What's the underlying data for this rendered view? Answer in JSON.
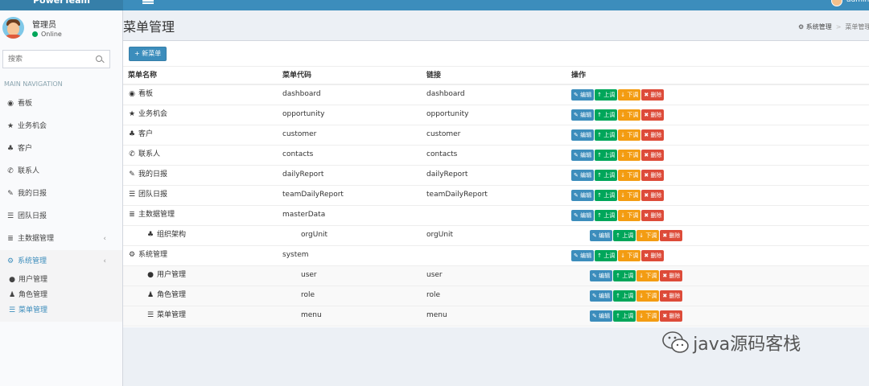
{
  "topbar": {
    "brand": "PowerTeam",
    "user": "admin"
  },
  "sidebar": {
    "user": {
      "name": "管理员",
      "status": "Online"
    },
    "search_placeholder": "搜索",
    "header": "MAIN NAVIGATION",
    "items": [
      {
        "label": "看板",
        "icon": "dashboard-icon"
      },
      {
        "label": "业务机会",
        "icon": "star-icon"
      },
      {
        "label": "客户",
        "icon": "sitemap-icon"
      },
      {
        "label": "联系人",
        "icon": "phone-icon"
      },
      {
        "label": "我的日报",
        "icon": "pin-icon"
      },
      {
        "label": "团队日报",
        "icon": "list-icon"
      },
      {
        "label": "主数据管理",
        "icon": "database-icon"
      },
      {
        "label": "系统管理",
        "icon": "cogs-icon"
      }
    ],
    "sub_items": [
      {
        "label": "用户管理",
        "icon": "user-icon"
      },
      {
        "label": "角色管理",
        "icon": "users-icon"
      },
      {
        "label": "菜单管理",
        "icon": "list-icon"
      }
    ]
  },
  "page": {
    "title": "菜单管理",
    "breadcrumb": {
      "parent": "系统管理",
      "current": "菜单管理"
    },
    "add_button": "+ 新菜单"
  },
  "table": {
    "headers": {
      "name": "菜单名称",
      "code": "菜单代码",
      "link": "链接",
      "actions": "操作"
    },
    "action_labels": {
      "edit": "编辑",
      "up": "上调",
      "down": "下调",
      "delete": "删除"
    },
    "rows": [
      {
        "name": "看板",
        "code": "dashboard",
        "link": "dashboard",
        "icon": "dashboard-icon"
      },
      {
        "name": "业务机会",
        "code": "opportunity",
        "link": "opportunity",
        "icon": "star-icon"
      },
      {
        "name": "客户",
        "code": "customer",
        "link": "customer",
        "icon": "sitemap-icon"
      },
      {
        "name": "联系人",
        "code": "contacts",
        "link": "contacts",
        "icon": "phone-icon"
      },
      {
        "name": "我的日报",
        "code": "dailyReport",
        "link": "dailyReport",
        "icon": "pin-icon"
      },
      {
        "name": "团队日报",
        "code": "teamDailyReport",
        "link": "teamDailyReport",
        "icon": "list-icon"
      },
      {
        "name": "主数据管理",
        "code": "masterData",
        "link": "",
        "icon": "database-icon"
      },
      {
        "name": "组织架构",
        "code": "orgUnit",
        "link": "orgUnit",
        "icon": "org-chart-icon"
      },
      {
        "name": "系统管理",
        "code": "system",
        "link": "",
        "icon": "cogs-icon"
      },
      {
        "name": "用户管理",
        "code": "user",
        "link": "user",
        "icon": "user-icon"
      },
      {
        "name": "角色管理",
        "code": "role",
        "link": "role",
        "icon": "users-icon"
      },
      {
        "name": "菜单管理",
        "code": "menu",
        "link": "menu",
        "icon": "list-icon"
      }
    ]
  },
  "watermark": {
    "text": "java源码客栈",
    "icon": "wechat-icon"
  }
}
